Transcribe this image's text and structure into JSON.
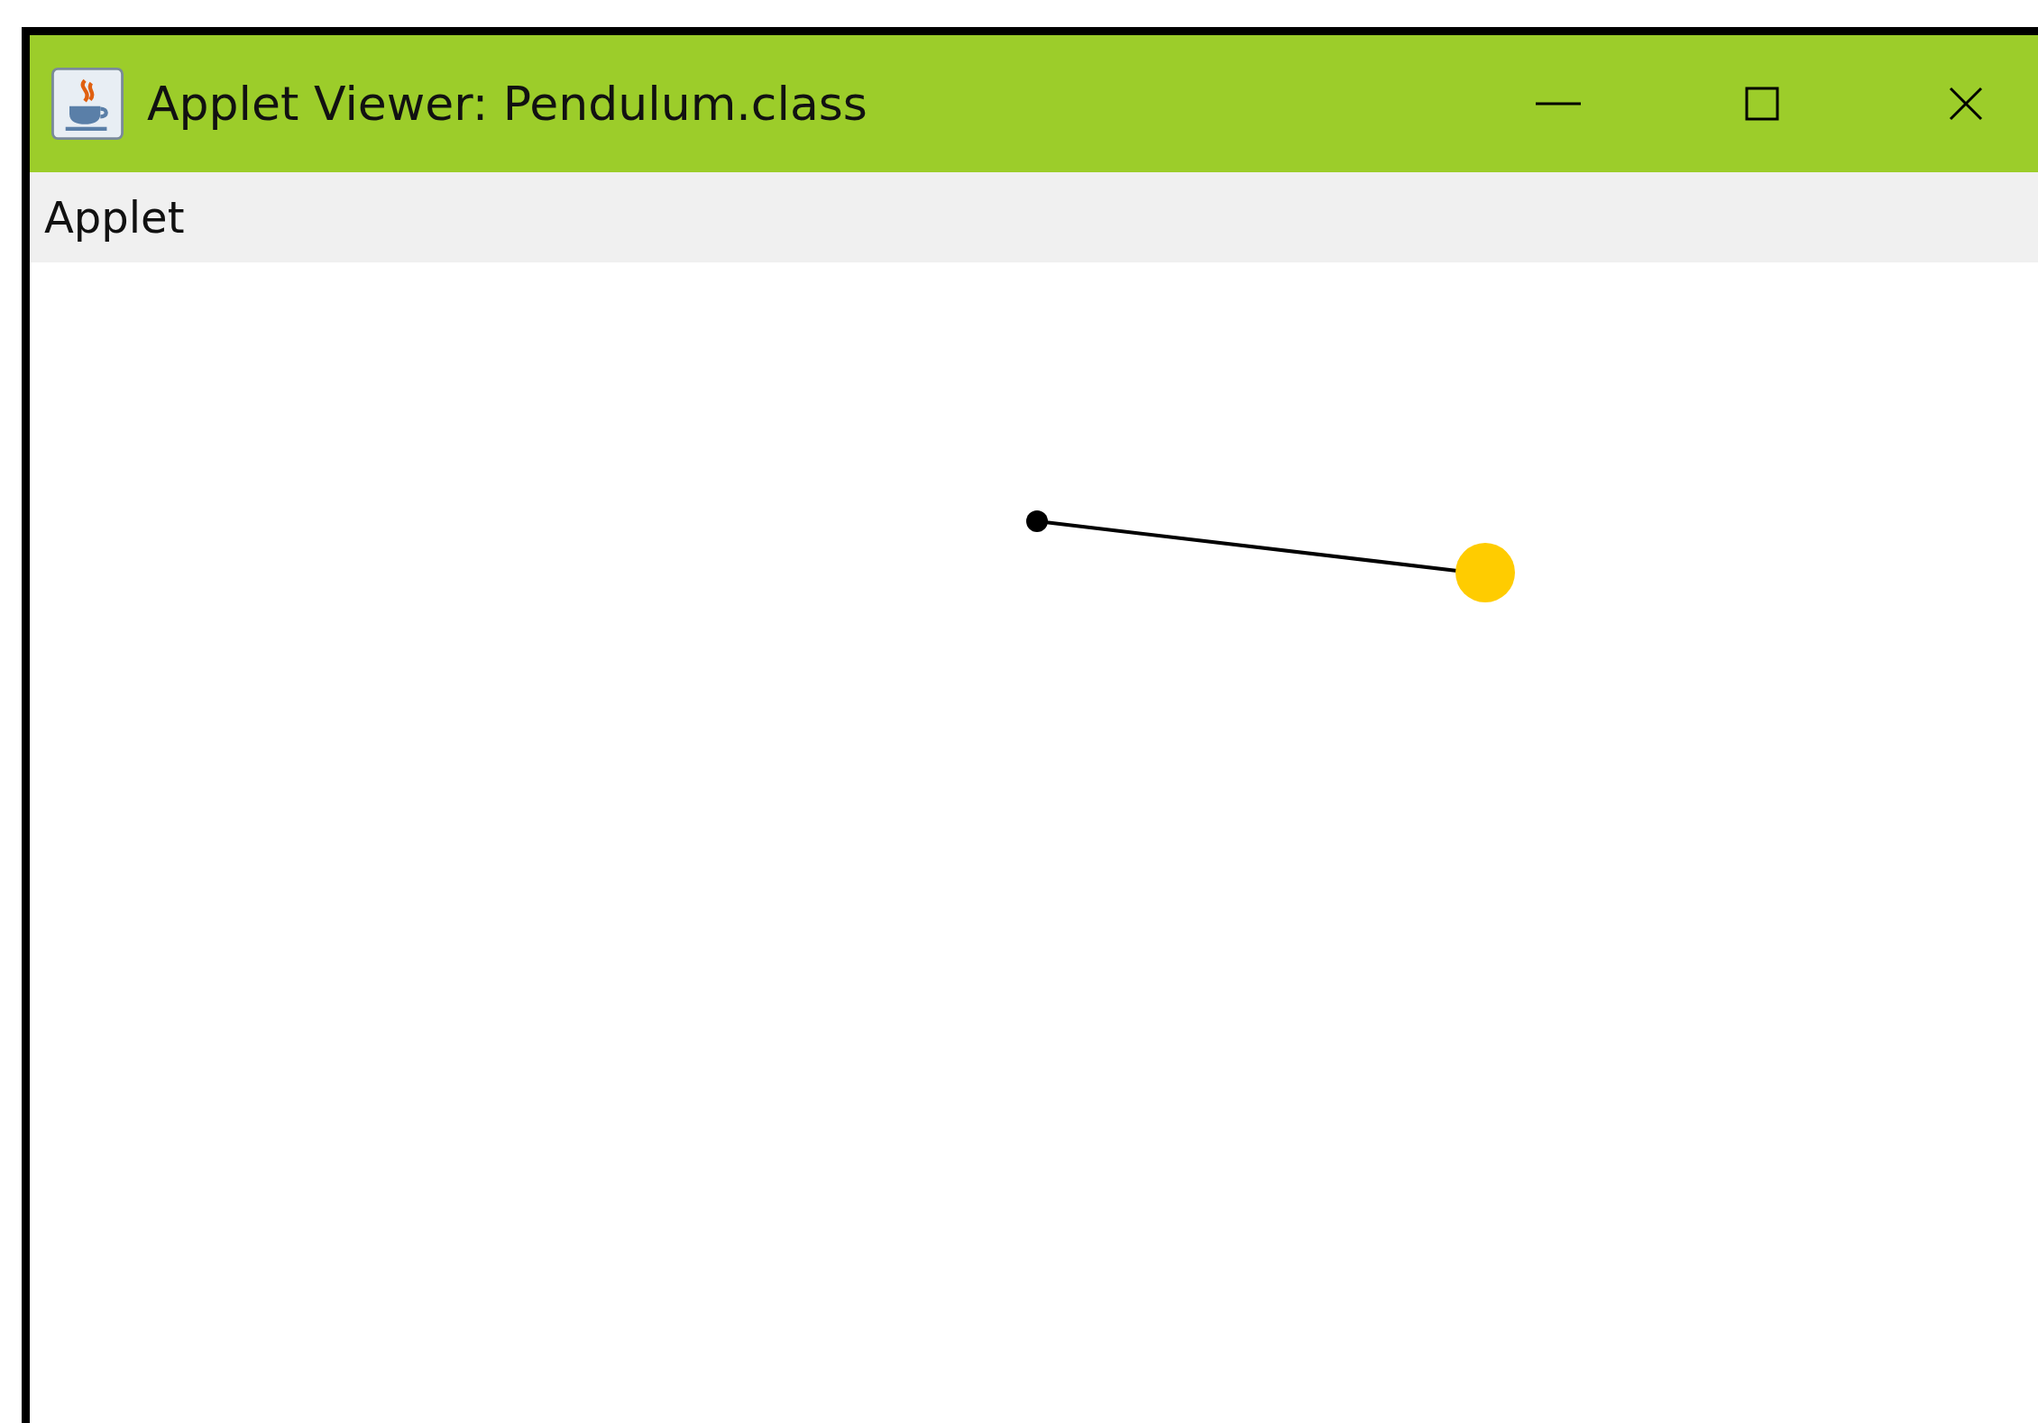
{
  "window": {
    "title": "Applet Viewer: Pendulum.class"
  },
  "menu_bar": {
    "items": [
      "Applet"
    ]
  }
}
